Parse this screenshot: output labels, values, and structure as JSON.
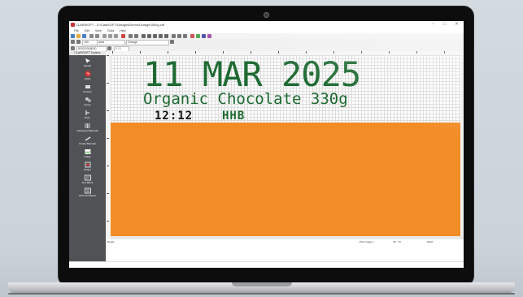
{
  "window": {
    "title": "CLARiSOFT - D:\\ClariSOFT\\Designs\\Demo\\Orange\\330\\g.ciff",
    "minimize": "−",
    "maximize": "□",
    "close": "✕"
  },
  "menu": [
    "File",
    "Edit",
    "View",
    "Tools",
    "Help"
  ],
  "toolbar": {
    "zoom_value": "100",
    "font_value": "Arial",
    "field_value": "Orange",
    "selector_value": "82022/018000",
    "page_value": "1 / 1"
  },
  "toolbox": {
    "title": "CLARiSOFT Toolbox",
    "items": [
      {
        "label": "Pointer",
        "icon": "pointer-icon"
      },
      {
        "label": "Clock",
        "icon": "clock-icon"
      },
      {
        "label": "Counter",
        "icon": "counter-icon"
      },
      {
        "label": "Group",
        "icon": "group-icon"
      },
      {
        "label": "Price",
        "icon": "price-icon"
      },
      {
        "label": "Interleaved Barcode",
        "icon": "barcode-icon"
      },
      {
        "label": "Create Barcode",
        "icon": "create-barcode-icon"
      },
      {
        "label": "Image",
        "icon": "image-icon"
      },
      {
        "label": "Shape",
        "icon": "shape-icon"
      },
      {
        "label": "Text Block",
        "icon": "text-block-icon"
      },
      {
        "label": "Rich Text Block",
        "icon": "rich-text-block-icon"
      }
    ]
  },
  "design": {
    "date": "11 MAR 2025",
    "product": "Organic Chocolate 330g",
    "time": "12:12",
    "code": "HHB"
  },
  "status": {
    "ready": "Ready",
    "printer": "Print Image 1",
    "position": "X0 : Y0",
    "mode": "NUM"
  },
  "colors": {
    "design_text": "#1e6b32",
    "background_band": "#f28c26",
    "toolbox_bg": "#505256"
  }
}
